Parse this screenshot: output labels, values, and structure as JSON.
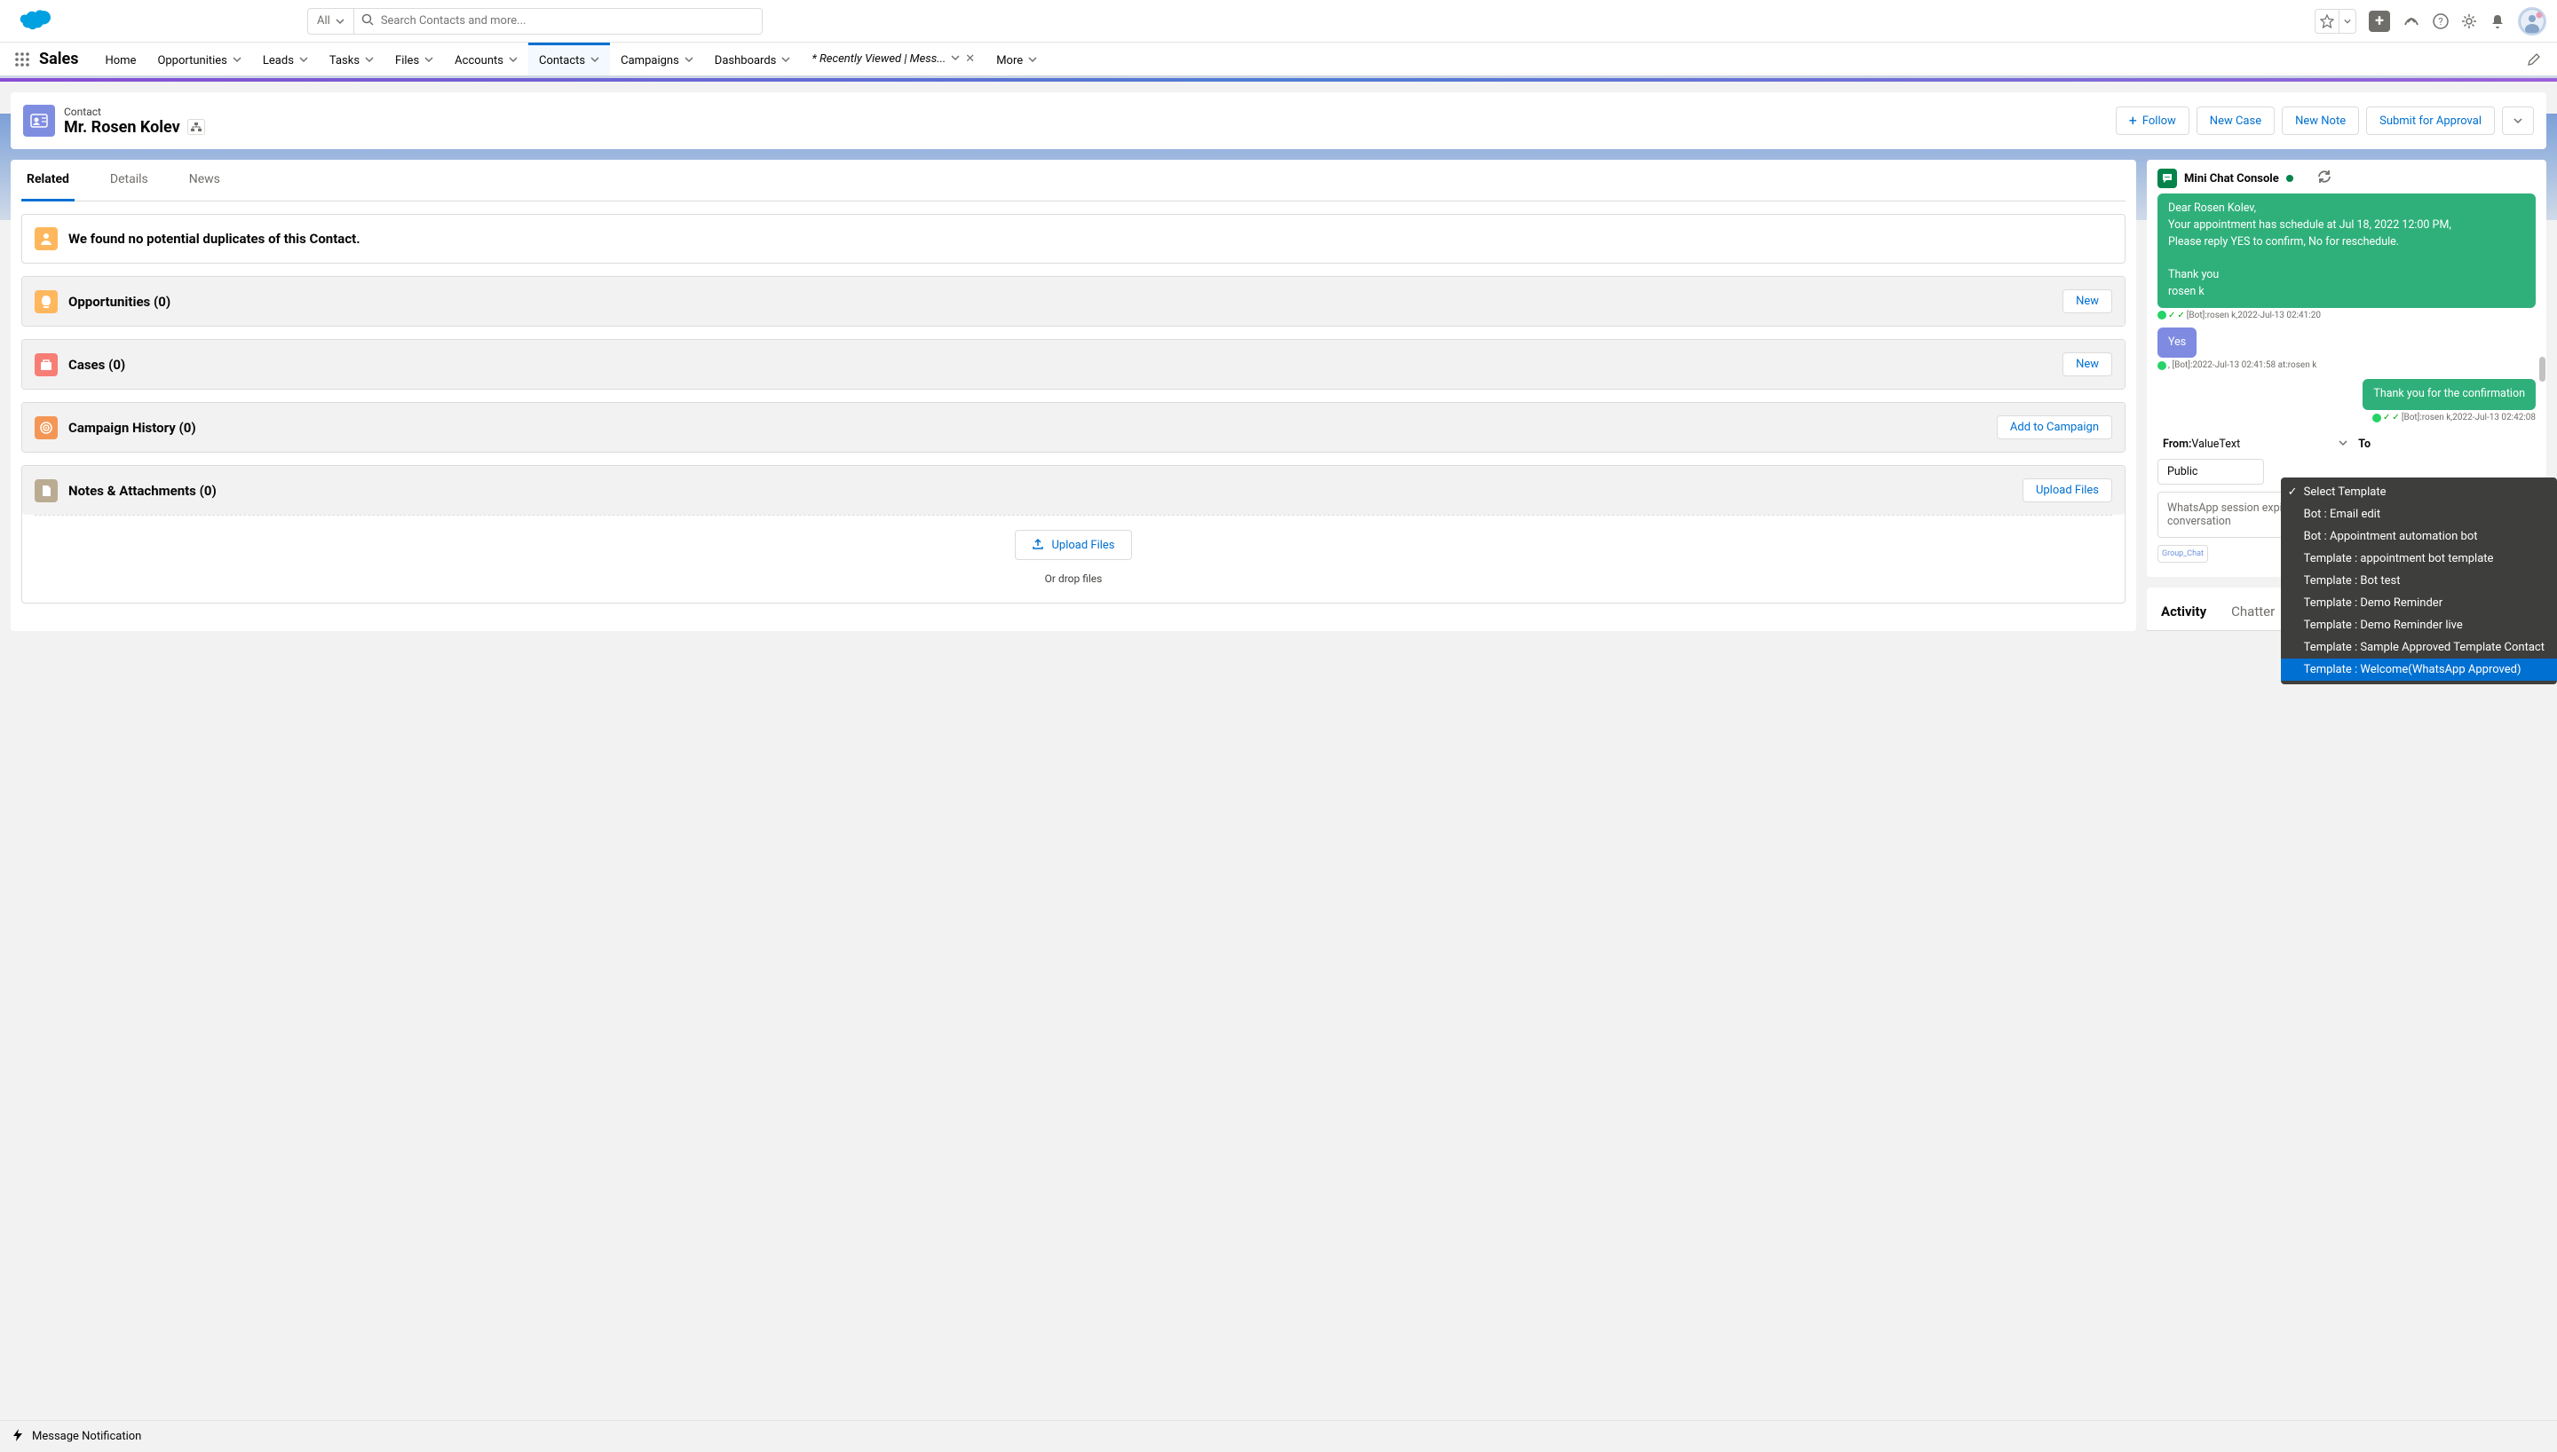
{
  "topbar": {
    "search_filter": "All",
    "search_placeholder": "Search Contacts and more..."
  },
  "nav": {
    "app_name": "Sales",
    "items": [
      "Home",
      "Opportunities",
      "Leads",
      "Tasks",
      "Files",
      "Accounts",
      "Contacts",
      "Campaigns",
      "Dashboards"
    ],
    "active": "Contacts",
    "pinned_tab": "* Recently Viewed | Mess...",
    "more": "More"
  },
  "record": {
    "object": "Contact",
    "title": "Mr. Rosen Kolev",
    "actions": {
      "follow": "Follow",
      "new_case": "New Case",
      "new_note": "New Note",
      "submit": "Submit for Approval"
    }
  },
  "tabs": {
    "related": "Related",
    "details": "Details",
    "news": "News"
  },
  "dup_msg": "We found no potential duplicates of this Contact.",
  "sections": {
    "opportunities": {
      "title": "Opportunities (0)",
      "action": "New"
    },
    "cases": {
      "title": "Cases (0)",
      "action": "New"
    },
    "campaign": {
      "title": "Campaign History (0)",
      "action": "Add to Campaign"
    },
    "notes": {
      "title": "Notes & Attachments (0)",
      "action": "Upload Files",
      "upload_btn": "Upload Files",
      "drop": "Or drop files"
    }
  },
  "chat": {
    "title": "Mini Chat Console",
    "msg1_l1": "Dear Rosen Kolev,",
    "msg1_l2": "Your appointment has schedule at Jul 18, 2022 12:00 PM,",
    "msg1_l3": "Please reply YES to confirm, No for reschedule.",
    "msg1_l4": "Thank you",
    "msg1_l5": "rosen k",
    "meta1": "[Bot]:rosen k,2022-Jul-13 02:41:20",
    "msg2": "Yes",
    "meta2": ", [Bot]:2022-Jul-13 02:41:58 at:rosen k",
    "msg3": "Thank you for the confirmation",
    "meta3": "[Bot]:rosen k,2022-Jul-13 02:42:08",
    "from_label": "From:",
    "from_value": "ValueText",
    "to_label": "To",
    "public": "Public",
    "input_placeholder": "WhatsApp session expired, Please choose template to initiate the conversation",
    "group_chat": "Group_Chat"
  },
  "activity": {
    "activity": "Activity",
    "chatter": "Chatter"
  },
  "dropdown": {
    "items": [
      "Select Template",
      "Bot : Email edit",
      "Bot : Appointment automation bot",
      "Template : appointment bot template",
      "Template : Bot test",
      "Template : Demo Reminder",
      "Template : Demo Reminder live",
      "Template : Sample Approved Template Contact",
      "Template : Welcome(WhatsApp Approved)"
    ],
    "selected_idx": 8,
    "check_idx": 0
  },
  "footer": {
    "msg_notif": "Message Notification"
  }
}
